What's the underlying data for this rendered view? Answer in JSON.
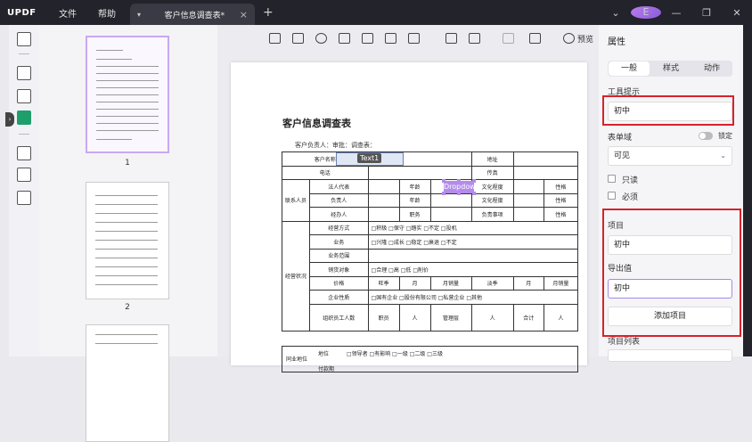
{
  "app": {
    "logo": "UPDF",
    "menus": [
      "文件",
      "帮助"
    ],
    "tab_title": "客户信息调查表*",
    "avatar_letter": "E"
  },
  "thumbnails": {
    "pages": [
      {
        "number": "1"
      },
      {
        "number": "2"
      },
      {
        "number": ""
      }
    ]
  },
  "toolbar": {
    "preview_label": "预览"
  },
  "document": {
    "title": "客户信息调查表",
    "subtitle": "客户负责人：审批：调查表：",
    "text_field_label": "Text1",
    "dropdown_field_label": "Dropdown",
    "rows": [
      [
        "客户名称",
        "",
        "",
        "",
        "地址",
        "",
        ""
      ],
      [
        "电话",
        "",
        "",
        "",
        "传真",
        "",
        ""
      ],
      [
        "法人代表",
        "",
        "年龄",
        "",
        "文化程度",
        "",
        "性格"
      ],
      [
        "负责人",
        "",
        "年龄",
        "",
        "文化程度",
        "",
        "性格"
      ],
      [
        "经办人",
        "",
        "职务",
        "",
        "负责事项",
        "",
        "性格"
      ],
      [
        "经营方式",
        "□积极 □保守 □踏实 □不定 □投机",
        "",
        "",
        "",
        "",
        ""
      ],
      [
        "业务",
        "□兴隆 □成长 □稳定 □衰退 □不定",
        "",
        "",
        "",
        "",
        ""
      ],
      [
        "业务范围",
        "",
        "",
        "",
        "",
        "",
        ""
      ],
      [
        "销货对象",
        "□合理 □高 □低 □削价",
        "",
        "",
        "",
        "",
        ""
      ],
      [
        "价格",
        "旺季",
        "月",
        "月销量",
        "淡季",
        "月",
        "月销量"
      ],
      [
        "企业性质",
        "□国有企业 □股份有限公司 □私营企业 □其他",
        "",
        "",
        "",
        "",
        ""
      ],
      [
        "组织员工人数",
        "职员",
        "人",
        "管理层",
        "人",
        "合计",
        "人"
      ],
      [
        "地位",
        "□领导者 □有影响 □一级 □二级 □三级",
        "",
        "",
        "",
        "",
        ""
      ],
      [
        "付款期",
        "",
        "",
        "",
        "",
        "",
        ""
      ]
    ],
    "group_labels": [
      "联系人员",
      "经营状况",
      "同业地位"
    ]
  },
  "properties": {
    "header": "属性",
    "tabs": [
      "一般",
      "样式",
      "动作"
    ],
    "active_tab": "一般",
    "tooltip_label": "工具提示",
    "tooltip_value": "初中",
    "form_field_label": "表单域",
    "lock_label": "锁定",
    "visibility_value": "可见",
    "readonly_label": "只读",
    "required_label": "必须",
    "item_label": "项目",
    "item_value": "初中",
    "export_value_label": "导出值",
    "export_value": "初中",
    "add_item_button": "添加项目",
    "item_list_label": "项目列表"
  },
  "colors": {
    "titlebar": "#23232b",
    "accent_purple": "#b48bea",
    "highlight_red": "#d6222a",
    "active_icon_green": "#1e9e6b"
  }
}
